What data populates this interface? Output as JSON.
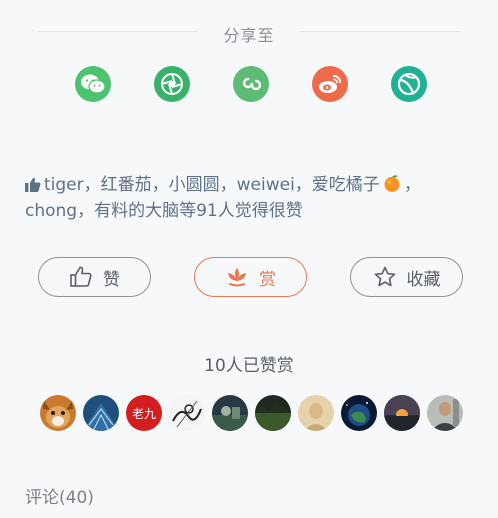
{
  "share": {
    "title": "分享至",
    "targets": [
      {
        "name": "wechat",
        "color": "#4cc36e"
      },
      {
        "name": "moments",
        "color": "#38b26b"
      },
      {
        "name": "mini-program",
        "color": "#5dbb73"
      },
      {
        "name": "weibo",
        "color": "#ef6a4a"
      },
      {
        "name": "other-share",
        "color": "#1fb295"
      }
    ]
  },
  "likes": {
    "names": "tiger，红番茄，小圆圆，weiwei，爱吃橘子",
    "tail": "，",
    "line2": "chong，有料的大脑等91人觉得很赞"
  },
  "actions": {
    "like_label": "赞",
    "reward_label": "赏",
    "collect_label": "收藏"
  },
  "rewards": {
    "count_text": "10人已赞赏",
    "avatars": [
      {
        "kind": "dog"
      },
      {
        "kind": "blue-pattern"
      },
      {
        "kind": "text",
        "text": "老九"
      },
      {
        "kind": "sketch"
      },
      {
        "kind": "photo-dark"
      },
      {
        "kind": "photo-forest"
      },
      {
        "kind": "photo-beige"
      },
      {
        "kind": "photo-earth"
      },
      {
        "kind": "photo-sunset"
      },
      {
        "kind": "photo-person"
      }
    ]
  },
  "comments": {
    "label": "评论(40)"
  },
  "colors": {
    "accent": "#e9784e",
    "link": "#5f7285"
  }
}
